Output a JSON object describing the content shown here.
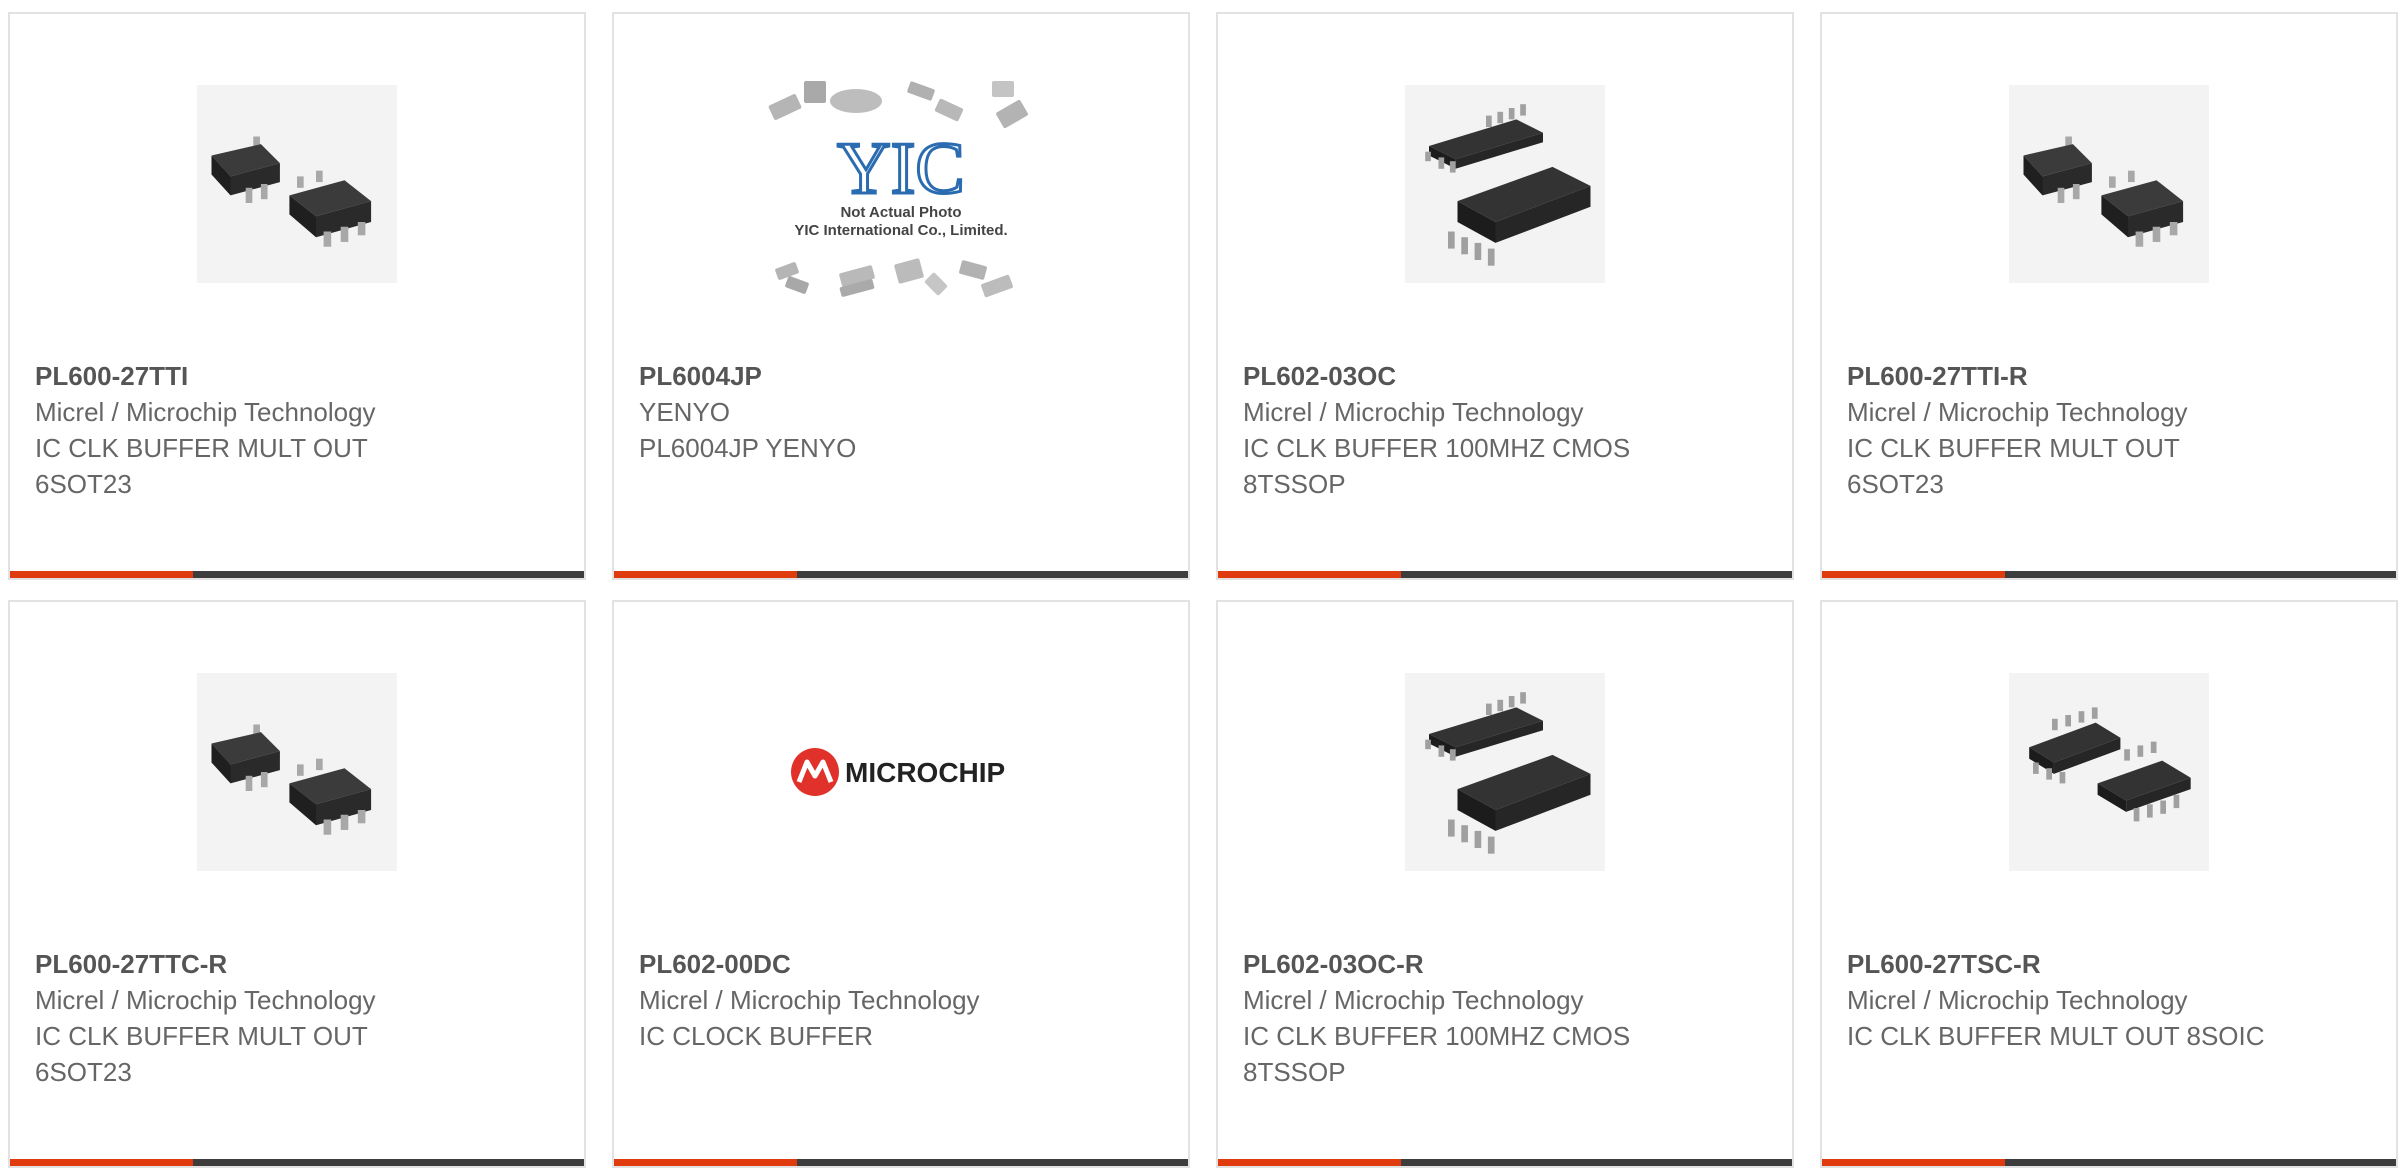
{
  "colors": {
    "card_border": "#e2e2e2",
    "part_number": "#555555",
    "body_text": "#666666",
    "bar_dark": "#3d3d3d",
    "bar_accent": "#e03a0f",
    "microchip_red": "#e0322a",
    "yic_blue": "#2b6cb0"
  },
  "products": [
    {
      "part_number": "PL600-27TTI",
      "manufacturer": "Micrel / Microchip Technology",
      "description": "IC CLK BUFFER MULT OUT 6SOT23",
      "image": "sot23-chip-icon"
    },
    {
      "part_number": "PL6004JP",
      "manufacturer": "YENYO",
      "description": "PL6004JP YENYO",
      "image": "yic-placeholder-icon",
      "image_text": {
        "logo": "YIC",
        "line1": "Not Actual Photo",
        "line2": "YIC International Co., Limited."
      }
    },
    {
      "part_number": "PL602-03OC",
      "manufacturer": "Micrel / Microchip Technology",
      "description": "IC CLK BUFFER 100MHZ CMOS 8TSSOP",
      "image": "tssop-chip-icon"
    },
    {
      "part_number": "PL600-27TTI-R",
      "manufacturer": "Micrel / Microchip Technology",
      "description": "IC CLK BUFFER MULT OUT 6SOT23",
      "image": "sot23-chip-icon"
    },
    {
      "part_number": "PL600-27TTC-R",
      "manufacturer": "Micrel / Microchip Technology",
      "description": "IC CLK BUFFER MULT OUT 6SOT23",
      "image": "sot23-chip-icon"
    },
    {
      "part_number": "PL602-00DC",
      "manufacturer": "Micrel / Microchip Technology",
      "description": "IC CLOCK BUFFER",
      "image": "microchip-logo-icon",
      "image_text": {
        "logo": "MICROCHIP"
      }
    },
    {
      "part_number": "PL602-03OC-R",
      "manufacturer": "Micrel / Microchip Technology",
      "description": "IC CLK BUFFER 100MHZ CMOS 8TSSOP",
      "image": "tssop-chip-icon"
    },
    {
      "part_number": "PL600-27TSC-R",
      "manufacturer": "Micrel / Microchip Technology",
      "description": "IC CLK BUFFER MULT OUT 8SOIC",
      "image": "soic-chip-icon"
    }
  ]
}
